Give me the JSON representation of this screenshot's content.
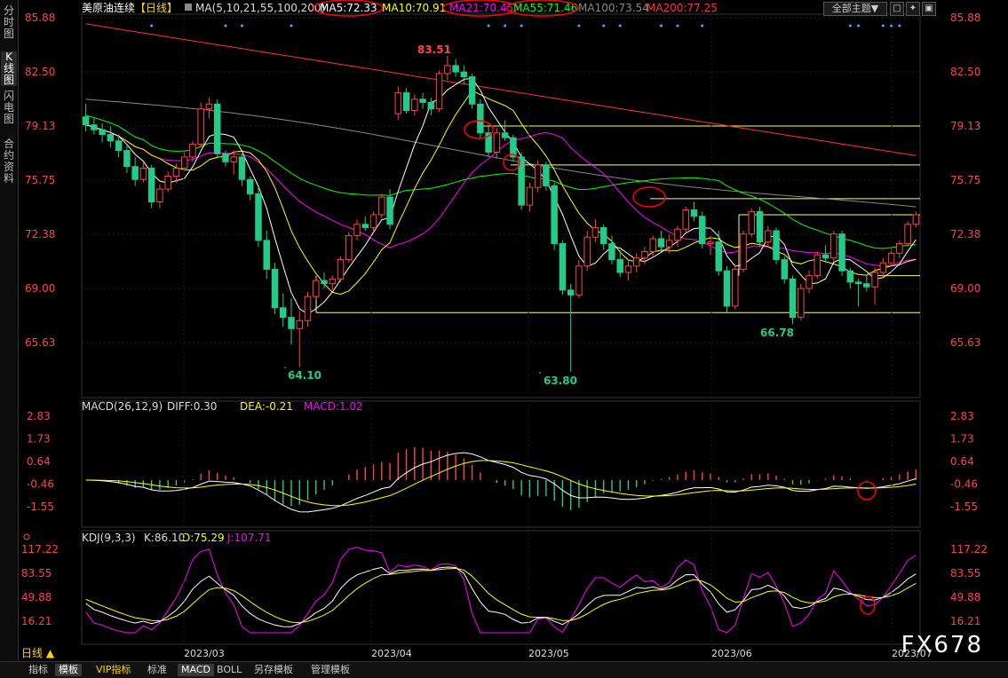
{
  "sidebar": {
    "tabs": [
      "分\n时\n图",
      "K\n线\n图",
      "闪\n电\n图",
      "合\n约\n资\n料"
    ],
    "active": 1
  },
  "top_controls": {
    "theme_button": "全部主题▼",
    "win_buttons": [
      "□",
      "✦",
      "▣"
    ]
  },
  "main_chart": {
    "symbol": "美原油连续",
    "period": "【日线】",
    "ma_params": "MA(5,10,21,55,100,200)",
    "ma_values": [
      {
        "label": "MA5:72.33",
        "color": "#ffffff",
        "circled": true
      },
      {
        "label": "MA10:70.91",
        "color": "#ffff00",
        "circled": false
      },
      {
        "label": "MA21:70.45",
        "color": "#ff00ff",
        "circled": true
      },
      {
        "label": "MA55:71.46",
        "color": "#00ff00",
        "circled": true
      },
      {
        "label": "MA100:73.54",
        "color": "#888888",
        "circled": false
      },
      {
        "label": "MA200:77.25",
        "color": "#ff3333",
        "circled": false
      }
    ],
    "y_ticks": [
      "85.88",
      "82.50",
      "79.13",
      "75.75",
      "72.38",
      "69.00",
      "65.63"
    ],
    "annotations": [
      "83.51",
      "64.10",
      "63.80",
      "66.78"
    ]
  },
  "macd_panel": {
    "title": "MACD(26,12,9)",
    "diff": "DIFF:0.30",
    "dea": "DEA:-0.21",
    "macd": "MACD:1.02",
    "y_ticks": [
      "2.83",
      "1.73",
      "0.64",
      "-0.46",
      "-1.55"
    ]
  },
  "kdj_panel": {
    "title": "KDJ(9,3,3)",
    "k": "K:86.10",
    "d": "D:75.29",
    "j": "J:107.71",
    "y_ticks": [
      "117.22",
      "83.55",
      "49.88",
      "16.21"
    ]
  },
  "x_axis": {
    "labels": [
      "2023/03",
      "2023/04",
      "2023/05",
      "2023/06",
      "2023/07"
    ]
  },
  "period_tag": "日线 ▲",
  "bottom_tabs": [
    "指标",
    "模板",
    "VIP指标",
    "标准",
    "MACD",
    "BOLL",
    "另存模板",
    "管理模板"
  ],
  "watermark": "FX678",
  "colors": {
    "up": "#ff4444",
    "down": "#22cc88",
    "axis_red": "#ff4444",
    "grid": "#2a2a2a"
  },
  "chart_data": [
    {
      "type": "candlestick",
      "title": "美原油连续【日线】",
      "ylim": [
        63.0,
        87.0
      ],
      "x_labels": [
        "2023/03",
        "2023/04",
        "2023/05",
        "2023/06",
        "2023/07"
      ],
      "ohlc": [
        [
          79.7,
          80.5,
          78.8,
          79.2
        ],
        [
          79.2,
          79.6,
          78.6,
          78.9
        ],
        [
          78.9,
          79.3,
          78.1,
          78.6
        ],
        [
          78.6,
          79.1,
          77.8,
          78.2
        ],
        [
          78.2,
          78.6,
          77.2,
          77.6
        ],
        [
          77.6,
          77.9,
          76.2,
          76.6
        ],
        [
          76.6,
          77.2,
          75.4,
          75.8
        ],
        [
          75.8,
          76.9,
          75.6,
          76.5
        ],
        [
          76.5,
          76.7,
          74.0,
          74.4
        ],
        [
          74.4,
          75.5,
          74.0,
          75.2
        ],
        [
          75.2,
          76.3,
          75.0,
          76.0
        ],
        [
          76.0,
          76.8,
          75.6,
          76.5
        ],
        [
          76.5,
          77.5,
          76.3,
          77.2
        ],
        [
          77.2,
          78.2,
          76.9,
          78.0
        ],
        [
          78.0,
          80.6,
          77.8,
          80.2
        ],
        [
          80.2,
          80.9,
          79.6,
          80.5
        ],
        [
          80.5,
          80.8,
          77.1,
          77.4
        ],
        [
          77.4,
          77.6,
          76.6,
          76.9
        ],
        [
          76.9,
          77.6,
          76.1,
          77.2
        ],
        [
          77.2,
          77.4,
          75.4,
          75.8
        ],
        [
          75.8,
          76.0,
          74.5,
          74.9
        ],
        [
          74.9,
          75.3,
          71.6,
          72.0
        ],
        [
          72.0,
          72.6,
          69.6,
          70.2
        ],
        [
          70.2,
          70.6,
          67.4,
          67.8
        ],
        [
          67.8,
          68.7,
          66.6,
          67.2
        ],
        [
          67.2,
          68.4,
          65.5,
          66.5
        ],
        [
          66.5,
          67.6,
          64.1,
          67.0
        ],
        [
          67.0,
          68.8,
          66.6,
          68.5
        ],
        [
          68.5,
          69.7,
          68.3,
          69.5
        ],
        [
          69.5,
          70.0,
          69.0,
          69.3
        ],
        [
          69.3,
          69.8,
          68.9,
          69.6
        ],
        [
          69.6,
          71.0,
          69.4,
          70.8
        ],
        [
          70.8,
          72.5,
          70.6,
          72.3
        ],
        [
          72.3,
          73.3,
          72.0,
          73.0
        ],
        [
          73.0,
          73.5,
          72.6,
          72.8
        ],
        [
          72.8,
          73.8,
          72.6,
          73.6
        ],
        [
          73.6,
          74.9,
          73.4,
          74.7
        ],
        [
          74.7,
          75.2,
          72.7,
          73.0
        ],
        [
          79.9,
          81.6,
          79.5,
          81.2
        ],
        [
          81.2,
          81.5,
          79.9,
          80.1
        ],
        [
          80.1,
          81.1,
          79.8,
          80.8
        ],
        [
          80.8,
          81.2,
          80.2,
          80.6
        ],
        [
          80.6,
          80.9,
          79.8,
          80.2
        ],
        [
          80.2,
          82.6,
          80.0,
          82.4
        ],
        [
          82.4,
          83.51,
          82.0,
          82.9
        ],
        [
          82.9,
          83.3,
          82.2,
          82.5
        ],
        [
          82.5,
          82.9,
          81.8,
          82.2
        ],
        [
          82.2,
          82.4,
          80.2,
          80.5
        ],
        [
          80.5,
          80.8,
          78.4,
          78.7
        ],
        [
          78.7,
          79.2,
          77.2,
          77.5
        ],
        [
          77.5,
          79.0,
          77.1,
          78.7
        ],
        [
          78.7,
          79.5,
          78.2,
          78.4
        ],
        [
          78.4,
          78.6,
          76.9,
          77.2
        ],
        [
          77.2,
          77.5,
          73.9,
          74.2
        ],
        [
          74.2,
          75.6,
          73.8,
          75.3
        ],
        [
          75.3,
          77.0,
          75.0,
          76.7
        ],
        [
          76.7,
          76.9,
          75.1,
          75.4
        ],
        [
          75.4,
          75.6,
          71.4,
          71.8
        ],
        [
          71.8,
          72.0,
          68.6,
          68.9
        ],
        [
          68.9,
          69.3,
          63.8,
          68.6
        ],
        [
          68.6,
          70.8,
          68.4,
          70.4
        ],
        [
          70.4,
          72.6,
          70.1,
          72.2
        ],
        [
          72.2,
          73.3,
          71.9,
          72.8
        ],
        [
          72.8,
          73.0,
          71.4,
          71.8
        ],
        [
          71.8,
          72.3,
          70.5,
          70.8
        ],
        [
          70.8,
          71.4,
          69.7,
          70.0
        ],
        [
          70.0,
          70.7,
          69.5,
          70.4
        ],
        [
          70.4,
          71.2,
          70.0,
          70.9
        ],
        [
          70.9,
          71.6,
          70.5,
          71.3
        ],
        [
          71.3,
          72.3,
          71.0,
          72.1
        ],
        [
          72.1,
          72.6,
          71.3,
          71.6
        ],
        [
          71.6,
          72.4,
          71.2,
          72.0
        ],
        [
          72.0,
          72.9,
          71.6,
          72.7
        ],
        [
          72.7,
          74.1,
          72.5,
          73.9
        ],
        [
          73.9,
          74.4,
          73.2,
          73.5
        ],
        [
          73.5,
          73.8,
          71.5,
          71.8
        ],
        [
          71.8,
          72.3,
          71.1,
          71.9
        ],
        [
          71.9,
          72.6,
          69.8,
          70.1
        ],
        [
          70.1,
          70.4,
          67.5,
          67.9
        ],
        [
          67.9,
          70.5,
          67.7,
          70.2
        ],
        [
          70.2,
          72.6,
          70.0,
          72.4
        ],
        [
          72.4,
          74.0,
          72.2,
          73.8
        ],
        [
          73.8,
          74.1,
          71.6,
          71.9
        ],
        [
          71.9,
          72.9,
          71.6,
          72.6
        ],
        [
          72.6,
          72.8,
          70.5,
          70.8
        ],
        [
          70.8,
          71.0,
          69.3,
          69.6
        ],
        [
          69.6,
          69.8,
          66.78,
          67.2
        ],
        [
          67.2,
          69.3,
          67.0,
          69.0
        ],
        [
          69.0,
          70.1,
          68.7,
          69.8
        ],
        [
          69.8,
          71.3,
          69.6,
          71.1
        ],
        [
          71.1,
          71.7,
          70.6,
          70.9
        ],
        [
          70.9,
          72.6,
          70.7,
          72.4
        ],
        [
          72.4,
          72.6,
          69.8,
          70.1
        ],
        [
          70.1,
          70.3,
          69.0,
          69.4
        ],
        [
          69.4,
          69.6,
          67.9,
          69.3
        ],
        [
          69.3,
          69.8,
          68.8,
          69.1
        ],
        [
          69.1,
          70.3,
          68.0,
          70.0
        ],
        [
          70.0,
          70.9,
          69.7,
          70.6
        ],
        [
          70.6,
          71.5,
          70.4,
          71.2
        ],
        [
          71.2,
          72.0,
          70.9,
          71.8
        ],
        [
          71.8,
          73.2,
          71.6,
          73.0
        ],
        [
          73.0,
          73.8,
          72.8,
          73.6
        ]
      ],
      "ma_lines_color": {
        "MA5": "#ffffff",
        "MA10": "#ffff00",
        "MA21": "#ff00ff",
        "MA55": "#00ff00",
        "MA100": "#888888",
        "MA200": "#ff3333"
      },
      "horizontal_levels": [
        79.13,
        76.7,
        74.6,
        73.6,
        69.8,
        67.5
      ]
    },
    {
      "type": "bar",
      "title": "MACD(26,12,9)",
      "ylim": [
        -2.2,
        3.2
      ],
      "series": [
        {
          "name": "DIFF"
        },
        {
          "name": "DEA"
        },
        {
          "name": "MACD"
        }
      ]
    },
    {
      "type": "line",
      "title": "KDJ(9,3,3)",
      "ylim": [
        0,
        130
      ],
      "series": [
        {
          "name": "K"
        },
        {
          "name": "D"
        },
        {
          "name": "J"
        }
      ]
    }
  ]
}
